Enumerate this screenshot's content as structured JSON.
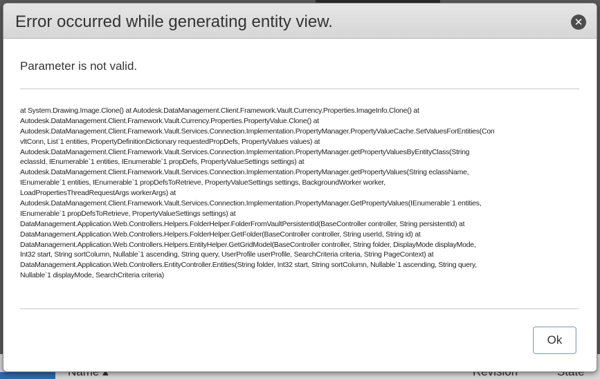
{
  "background": {
    "column_name": "Name ▴",
    "column_revision": "Revision",
    "column_state": "State"
  },
  "dialog": {
    "title": "Error occurred while generating entity view.",
    "close_icon": "close-circle-icon",
    "message": "Parameter is not valid.",
    "stack_lines": [
      "at System.Drawing.Image.Clone() at Autodesk.DataManagement.Client.Framework.Vault.Currency.Properties.ImageInfo.Clone() at",
      "Autodesk.DataManagement.Client.Framework.Vault.Currency.Properties.PropertyValue.Clone() at",
      "Autodesk.DataManagement.Client.Framework.Vault.Services.Connection.Implementation.PropertyManager.PropertyValueCache.SetValuesForEntities(Con",
      "vltConn, List`1 entities, PropertyDefinitionDictionary requestedPropDefs, PropertyValues values) at",
      "Autodesk.DataManagement.Client.Framework.Vault.Services.Connection.Implementation.PropertyManager.getPropertyValuesByEntityClass(String",
      "eclassId, IEnumerable`1 entities, IEnumerable`1 propDefs, PropertyValueSettings settings) at",
      "Autodesk.DataManagement.Client.Framework.Vault.Services.Connection.Implementation.PropertyManager.getPropertyValues(String eclassName,",
      "IEnumerable`1 entities, IEnumerable`1 propDefsToRetrieve, PropertyValueSettings settings, BackgroundWorker worker,",
      "LoadPropertiesThreadRequestArgs workerArgs) at",
      "Autodesk.DataManagement.Client.Framework.Vault.Services.Connection.Implementation.PropertyManager.GetPropertyValues(IEnumerable`1 entities,",
      "IEnumerable`1 propDefsToRetrieve, PropertyValueSettings settings) at",
      "DataManagement.Application.Web.Controllers.Helpers.FolderHelper.FolderFromVaultPersistentId(BaseController controller, String persistentId) at",
      "DataManagement.Application.Web.Controllers.Helpers.FolderHelper.GetFolder(BaseController controller, String userId, String id) at",
      "DataManagement.Application.Web.Controllers.Helpers.EntityHelper.GetGridModel(BaseController controller, String folder, DisplayMode displayMode,",
      "Int32 start, String sortColumn, Nullable`1 ascending, String query, UserProfile userProfile, SearchCriteria criteria, String PageContext) at",
      "DataManagement.Application.Web.Controllers.EntityController.Entities(String folder, Int32 start, String sortColumn, Nullable`1 ascending, String query,",
      "Nullable`1 displayMode, SearchCriteria criteria)"
    ],
    "ok_label": "Ok"
  }
}
